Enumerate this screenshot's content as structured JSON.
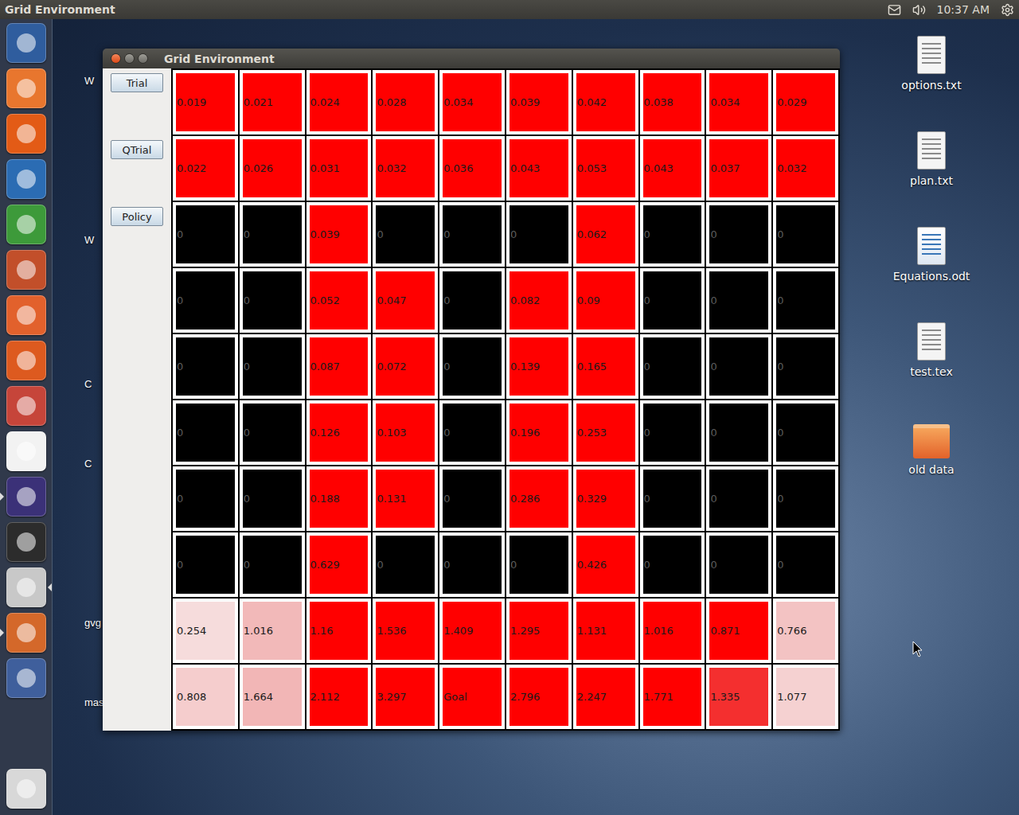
{
  "top_bar": {
    "title": "Grid Environment",
    "time": "10:37 AM"
  },
  "launcher": [
    {
      "color": "#2f5d9e",
      "running": false,
      "active": false
    },
    {
      "color": "#e8762e",
      "running": false,
      "active": false
    },
    {
      "color": "#e35b16",
      "running": false,
      "active": false
    },
    {
      "color": "#2b6cb3",
      "running": false,
      "active": false
    },
    {
      "color": "#3d9a3a",
      "running": false,
      "active": false
    },
    {
      "color": "#c24f2a",
      "running": false,
      "active": false
    },
    {
      "color": "#e2612c",
      "running": false,
      "active": false
    },
    {
      "color": "#dd5a1f",
      "running": false,
      "active": false
    },
    {
      "color": "#c6453a",
      "running": false,
      "active": false
    },
    {
      "color": "#f2f2f2",
      "running": false,
      "active": false
    },
    {
      "color": "#3b3178",
      "running": true,
      "active": false
    },
    {
      "color": "#2c2c2c",
      "running": false,
      "active": false
    },
    {
      "color": "#c8c8c8",
      "running": false,
      "active": true
    },
    {
      "color": "#d4682a",
      "running": true,
      "active": false
    },
    {
      "color": "#3f5f9c",
      "running": false,
      "active": false
    }
  ],
  "trash": {
    "color": "#d8d8d8"
  },
  "desktop_icons": [
    {
      "label": "options.txt",
      "kind": "text"
    },
    {
      "label": "plan.txt",
      "kind": "text"
    },
    {
      "label": "Equations.odt",
      "kind": "document"
    },
    {
      "label": "test.tex",
      "kind": "text"
    },
    {
      "label": "old data",
      "kind": "folder"
    }
  ],
  "hidden_labels": [
    "W",
    "W",
    "C",
    "C",
    "gvg",
    "mas"
  ],
  "window": {
    "title": "Grid Environment",
    "buttons": [
      {
        "label": "Trial"
      },
      {
        "label": "QTrial"
      },
      {
        "label": "Policy"
      }
    ],
    "grid": [
      [
        {
          "value": "0.019",
          "color": "#ff0000"
        },
        {
          "value": "0.021",
          "color": "#ff0000"
        },
        {
          "value": "0.024",
          "color": "#ff0000"
        },
        {
          "value": "0.028",
          "color": "#ff0000"
        },
        {
          "value": "0.034",
          "color": "#ff0000"
        },
        {
          "value": "0.039",
          "color": "#ff0000"
        },
        {
          "value": "0.042",
          "color": "#ff0000"
        },
        {
          "value": "0.038",
          "color": "#ff0000"
        },
        {
          "value": "0.034",
          "color": "#ff0000"
        },
        {
          "value": "0.029",
          "color": "#ff0000"
        }
      ],
      [
        {
          "value": "0.022",
          "color": "#ff0000"
        },
        {
          "value": "0.026",
          "color": "#ff0000"
        },
        {
          "value": "0.031",
          "color": "#ff0000"
        },
        {
          "value": "0.032",
          "color": "#ff0000"
        },
        {
          "value": "0.036",
          "color": "#ff0000"
        },
        {
          "value": "0.043",
          "color": "#ff0000"
        },
        {
          "value": "0.053",
          "color": "#ff0000"
        },
        {
          "value": "0.043",
          "color": "#ff0000"
        },
        {
          "value": "0.037",
          "color": "#ff0000"
        },
        {
          "value": "0.032",
          "color": "#ff0000"
        }
      ],
      [
        {
          "value": "0",
          "color": "#000000"
        },
        {
          "value": "0",
          "color": "#000000"
        },
        {
          "value": "0.039",
          "color": "#ff0000"
        },
        {
          "value": "0",
          "color": "#000000"
        },
        {
          "value": "0",
          "color": "#000000"
        },
        {
          "value": "0",
          "color": "#000000"
        },
        {
          "value": "0.062",
          "color": "#ff0000"
        },
        {
          "value": "0",
          "color": "#000000"
        },
        {
          "value": "0",
          "color": "#000000"
        },
        {
          "value": "0",
          "color": "#000000"
        }
      ],
      [
        {
          "value": "0",
          "color": "#000000"
        },
        {
          "value": "0",
          "color": "#000000"
        },
        {
          "value": "0.052",
          "color": "#ff0000"
        },
        {
          "value": "0.047",
          "color": "#ff0000"
        },
        {
          "value": "0",
          "color": "#000000"
        },
        {
          "value": "0.082",
          "color": "#ff0000"
        },
        {
          "value": "0.09",
          "color": "#ff0000"
        },
        {
          "value": "0",
          "color": "#000000"
        },
        {
          "value": "0",
          "color": "#000000"
        },
        {
          "value": "0",
          "color": "#000000"
        }
      ],
      [
        {
          "value": "0",
          "color": "#000000"
        },
        {
          "value": "0",
          "color": "#000000"
        },
        {
          "value": "0.087",
          "color": "#ff0000"
        },
        {
          "value": "0.072",
          "color": "#ff0000"
        },
        {
          "value": "0",
          "color": "#000000"
        },
        {
          "value": "0.139",
          "color": "#ff0000"
        },
        {
          "value": "0.165",
          "color": "#ff0000"
        },
        {
          "value": "0",
          "color": "#000000"
        },
        {
          "value": "0",
          "color": "#000000"
        },
        {
          "value": "0",
          "color": "#000000"
        }
      ],
      [
        {
          "value": "0",
          "color": "#000000"
        },
        {
          "value": "0",
          "color": "#000000"
        },
        {
          "value": "0.126",
          "color": "#ff0000"
        },
        {
          "value": "0.103",
          "color": "#ff0000"
        },
        {
          "value": "0",
          "color": "#000000"
        },
        {
          "value": "0.196",
          "color": "#ff0000"
        },
        {
          "value": "0.253",
          "color": "#ff0000"
        },
        {
          "value": "0",
          "color": "#000000"
        },
        {
          "value": "0",
          "color": "#000000"
        },
        {
          "value": "0",
          "color": "#000000"
        }
      ],
      [
        {
          "value": "0",
          "color": "#000000"
        },
        {
          "value": "0",
          "color": "#000000"
        },
        {
          "value": "0.188",
          "color": "#ff0000"
        },
        {
          "value": "0.131",
          "color": "#ff0000"
        },
        {
          "value": "0",
          "color": "#000000"
        },
        {
          "value": "0.286",
          "color": "#ff0000"
        },
        {
          "value": "0.329",
          "color": "#ff0000"
        },
        {
          "value": "0",
          "color": "#000000"
        },
        {
          "value": "0",
          "color": "#000000"
        },
        {
          "value": "0",
          "color": "#000000"
        }
      ],
      [
        {
          "value": "0",
          "color": "#000000"
        },
        {
          "value": "0",
          "color": "#000000"
        },
        {
          "value": "0.629",
          "color": "#ff0000"
        },
        {
          "value": "0",
          "color": "#000000"
        },
        {
          "value": "0",
          "color": "#000000"
        },
        {
          "value": "0",
          "color": "#000000"
        },
        {
          "value": "0.426",
          "color": "#ff0000"
        },
        {
          "value": "0",
          "color": "#000000"
        },
        {
          "value": "0",
          "color": "#000000"
        },
        {
          "value": "0",
          "color": "#000000"
        }
      ],
      [
        {
          "value": "0.254",
          "color": "#f6dcdc"
        },
        {
          "value": "1.016",
          "color": "#f2b9b9"
        },
        {
          "value": "1.16",
          "color": "#ff0000"
        },
        {
          "value": "1.536",
          "color": "#ff0000"
        },
        {
          "value": "1.409",
          "color": "#ff0000"
        },
        {
          "value": "1.295",
          "color": "#ff0000"
        },
        {
          "value": "1.131",
          "color": "#ff0000"
        },
        {
          "value": "1.016",
          "color": "#ff0000"
        },
        {
          "value": "0.871",
          "color": "#ff0000"
        },
        {
          "value": "0.766",
          "color": "#f3c3c3"
        }
      ],
      [
        {
          "value": "0.808",
          "color": "#f5cdcd"
        },
        {
          "value": "1.664",
          "color": "#f2b6b6"
        },
        {
          "value": "2.112",
          "color": "#ff0000"
        },
        {
          "value": "3.297",
          "color": "#ff0000"
        },
        {
          "value": "Goal",
          "color": "#ff0000"
        },
        {
          "value": "2.796",
          "color": "#ff0000"
        },
        {
          "value": "2.247",
          "color": "#ff0000"
        },
        {
          "value": "1.771",
          "color": "#ff0000"
        },
        {
          "value": "1.335",
          "color": "#f42f2f"
        },
        {
          "value": "1.077",
          "color": "#f5d1d1"
        }
      ]
    ]
  }
}
